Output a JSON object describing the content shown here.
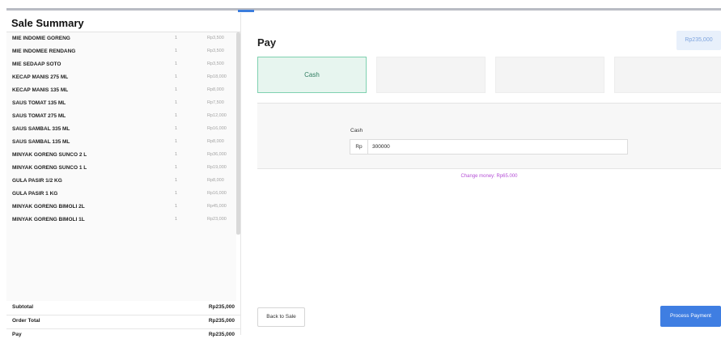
{
  "sale_summary": {
    "title": "Sale Summary",
    "items": [
      {
        "name": "MIE INDOMIE GORENG",
        "qty": "1",
        "price": "Rp3,500"
      },
      {
        "name": "MIE INDOMEE RENDANG",
        "qty": "1",
        "price": "Rp3,500"
      },
      {
        "name": "MIE SEDAAP SOTO",
        "qty": "1",
        "price": "Rp3,500"
      },
      {
        "name": "KECAP MANIS 275 ML",
        "qty": "1",
        "price": "Rp18,000"
      },
      {
        "name": "KECAP MANIS 135 ML",
        "qty": "1",
        "price": "Rp8,000"
      },
      {
        "name": "SAUS TOMAT 135 ML",
        "qty": "1",
        "price": "Rp7,500"
      },
      {
        "name": "SAUS TOMAT 275 ML",
        "qty": "1",
        "price": "Rp12,000"
      },
      {
        "name": "SAUS SAMBAL 335 ML",
        "qty": "1",
        "price": "Rp16,000"
      },
      {
        "name": "SAUS SAMBAL 135 ML",
        "qty": "1",
        "price": "Rp8,000"
      },
      {
        "name": "MINYAK GORENG SUNCO 2 L",
        "qty": "1",
        "price": "Rp36,000"
      },
      {
        "name": "MINYAK GORENG SUNCO 1 L",
        "qty": "1",
        "price": "Rp19,000"
      },
      {
        "name": "GULA PASIR 1/2 KG",
        "qty": "1",
        "price": "Rp8,000"
      },
      {
        "name": "GULA PASIR 1 KG",
        "qty": "1",
        "price": "Rp16,000"
      },
      {
        "name": "MINYAK GORENG BIMOLI 2L",
        "qty": "1",
        "price": "Rp45,000"
      },
      {
        "name": "MINYAK GORENG BIMOLI 1L",
        "qty": "1",
        "price": "Rp23,000"
      }
    ],
    "subtotal_label": "Subtotal",
    "subtotal_value": "Rp235,000",
    "order_total_label": "Order Total",
    "order_total_value": "Rp235,000",
    "pay_label": "Pay",
    "pay_value": "Rp235,000"
  },
  "pay_panel": {
    "title": "Pay",
    "amount_badge": "Rp235,000",
    "methods": [
      {
        "label": "Cash",
        "active": true
      },
      {
        "label": "",
        "active": false
      },
      {
        "label": "",
        "active": false
      },
      {
        "label": "",
        "active": false
      }
    ],
    "cash_label": "Cash",
    "currency_prefix": "Rp",
    "cash_value": "300000",
    "change_text": "Change money: Rp65.000",
    "back_button": "Back to Sale",
    "process_button": "Process Payment"
  },
  "colors": {
    "accent": "#3f7ee2",
    "cash_active_bg": "#e7f5ef",
    "change_text": "#b54fd6"
  }
}
